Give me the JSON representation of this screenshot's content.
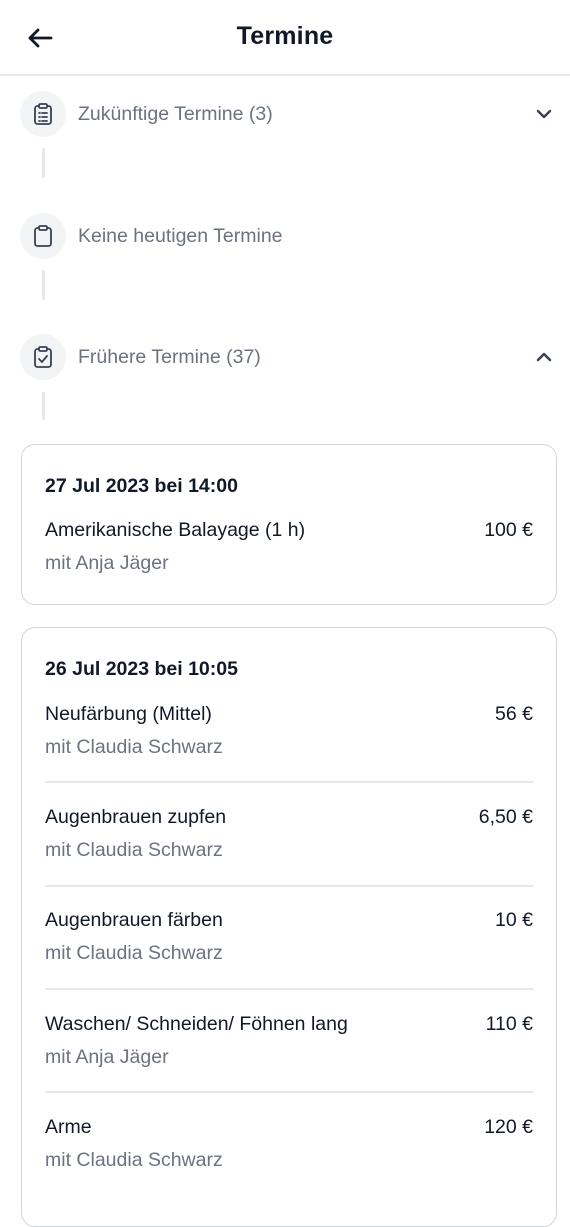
{
  "header": {
    "title": "Termine"
  },
  "sections": {
    "upcoming": "Zukünftige Termine (3)",
    "today": "Keine heutigen Termine",
    "past": "Frühere Termine (37)"
  },
  "cards": [
    {
      "date": "27 Jul 2023 bei 14:00",
      "items": [
        {
          "service": "Amerikanische Balayage (1 h)",
          "price": "100 €",
          "staff": "mit Anja Jäger"
        }
      ]
    },
    {
      "date": "26 Jul 2023 bei 10:05",
      "items": [
        {
          "service": "Neufärbung (Mittel)",
          "price": "56 €",
          "staff": "mit Claudia Schwarz"
        },
        {
          "service": "Augenbrauen zupfen",
          "price": "6,50 €",
          "staff": "mit Claudia Schwarz"
        },
        {
          "service": "Augenbrauen färben",
          "price": "10 €",
          "staff": "mit Claudia Schwarz"
        },
        {
          "service": "Waschen/ Schneiden/ Föhnen lang",
          "price": "110 €",
          "staff": "mit Anja Jäger"
        },
        {
          "service": "Arme",
          "price": "120 €",
          "staff": "mit Claudia Schwarz"
        }
      ]
    }
  ]
}
